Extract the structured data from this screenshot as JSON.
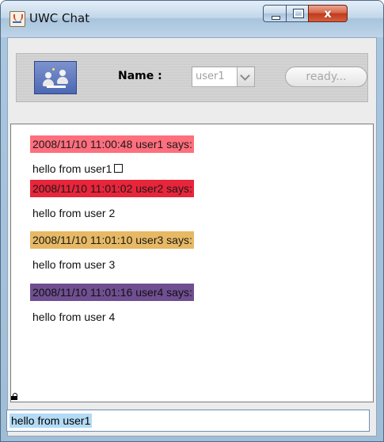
{
  "window": {
    "title": "UWC Chat",
    "close_glyph": "x",
    "icons": [
      "java-app-icon",
      "minimize-icon",
      "maximize-icon",
      "close-icon"
    ]
  },
  "toolbar": {
    "logo_icon": "meeting-people-icon",
    "name_label": "Name :",
    "name_select": {
      "selected": "user1"
    },
    "ready_button_label": "ready..."
  },
  "chat": {
    "messages": [
      {
        "header": "2008/11/10 11:00:48  user1 says:",
        "header_bg": "#ff6f7d",
        "header_fg": "#1a1a1a",
        "body": "hello from user1",
        "trailing_box": true
      },
      {
        "header": "2008/11/10 11:01:02  user2 says:",
        "header_bg": "#e8253a",
        "header_fg": "#1a1a1a",
        "body": "hello from user 2",
        "trailing_box": false
      },
      {
        "header": "2008/11/10 11:01:10  user3 says:",
        "header_bg": "#e7b964",
        "header_fg": "#1a1a1a",
        "body": "hello from user 3",
        "trailing_box": false
      },
      {
        "header": "2008/11/10 11:01:16  user4 says:",
        "header_bg": "#6f4f91",
        "header_fg": "#111111",
        "body": "hello from user 4",
        "trailing_box": false
      }
    ]
  },
  "input": {
    "value": "hello from user1"
  },
  "colors": {
    "selection_highlight": "#b3dbf5",
    "frame": "#a0bdd6"
  }
}
